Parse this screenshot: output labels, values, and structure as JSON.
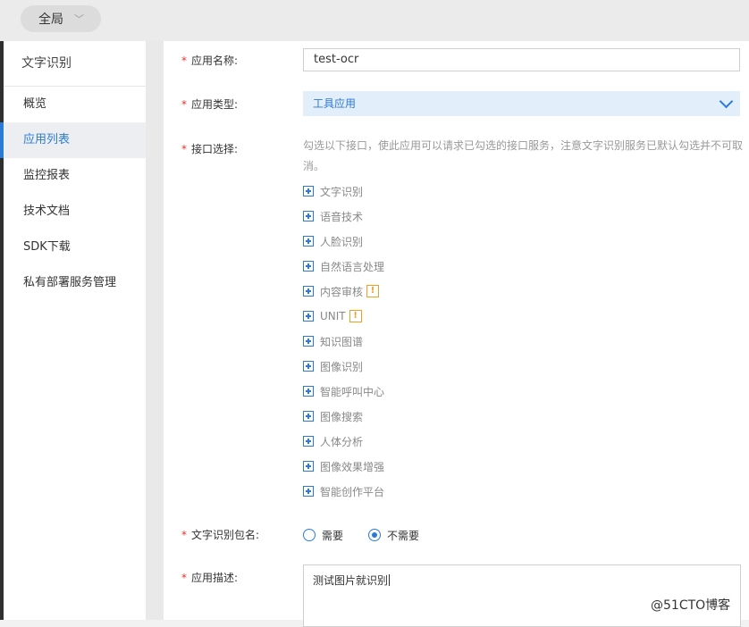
{
  "topbar": {
    "scope_label": "全局"
  },
  "sidebar": {
    "title": "文字识别",
    "items": [
      {
        "label": "概览"
      },
      {
        "label": "应用列表"
      },
      {
        "label": "监控报表"
      },
      {
        "label": "技术文档"
      },
      {
        "label": "SDK下载"
      },
      {
        "label": "私有部署服务管理"
      }
    ],
    "active_index": 1
  },
  "form": {
    "required_mark": "*",
    "app_name": {
      "label": "应用名称:",
      "value": "test-ocr"
    },
    "app_type": {
      "label": "应用类型:",
      "value": "工具应用"
    },
    "api_select": {
      "label": "接口选择:",
      "hint": "勾选以下接口，使此应用可以请求已勾选的接口服务，注意文字识别服务已默认勾选并不可取消。",
      "items": [
        {
          "label": "文字识别",
          "badge": ""
        },
        {
          "label": "语音技术",
          "badge": ""
        },
        {
          "label": "人脸识别",
          "badge": ""
        },
        {
          "label": "自然语言处理",
          "badge": ""
        },
        {
          "label": "内容审核",
          "badge": "!"
        },
        {
          "label": "UNIT",
          "badge": "!"
        },
        {
          "label": "知识图谱",
          "badge": ""
        },
        {
          "label": "图像识别",
          "badge": ""
        },
        {
          "label": "智能呼叫中心",
          "badge": ""
        },
        {
          "label": "图像搜索",
          "badge": ""
        },
        {
          "label": "人体分析",
          "badge": ""
        },
        {
          "label": "图像效果增强",
          "badge": ""
        },
        {
          "label": "智能创作平台",
          "badge": ""
        }
      ]
    },
    "package_name": {
      "label": "文字识别包名:",
      "options": [
        {
          "label": "需要",
          "checked": false
        },
        {
          "label": "不需要",
          "checked": true
        }
      ]
    },
    "description": {
      "label": "应用描述:",
      "value": "测试图片就识别"
    }
  },
  "watermark": "@51CTO博客",
  "colors": {
    "accent": "#2b7bd6",
    "required": "#e5322d",
    "warning": "#f0a020"
  }
}
